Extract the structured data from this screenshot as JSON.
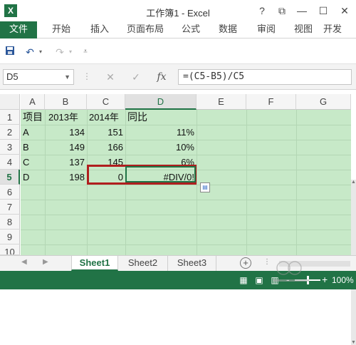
{
  "window": {
    "app_icon": "X",
    "title": "工作簿1 - Excel",
    "help": "?",
    "ribbon_display": "⧉",
    "minimize": "—",
    "maximize": "☐",
    "close": "✕"
  },
  "ribbon": {
    "tabs": [
      "文件",
      "开始",
      "插入",
      "页面布局",
      "公式",
      "数据",
      "审阅",
      "视图",
      "开发"
    ]
  },
  "qat": {
    "save_icon": "save-icon",
    "undo_icon": "undo-icon",
    "redo_icon": "redo-icon"
  },
  "formula_bar": {
    "name_box": "D5",
    "cancel": "✕",
    "enter": "✓",
    "fx": "fx",
    "formula": "=(C5-B5)/C5"
  },
  "grid": {
    "columns": [
      "A",
      "B",
      "C",
      "D",
      "E",
      "F",
      "G"
    ],
    "selected_column": "D",
    "rows": [
      "1",
      "2",
      "3",
      "4",
      "5",
      "6",
      "7",
      "8",
      "9",
      "10"
    ],
    "selected_row": "5",
    "header": [
      "项目",
      "2013年",
      "2014年",
      "同比"
    ],
    "data": [
      [
        "A",
        "134",
        "151",
        "11%"
      ],
      [
        "B",
        "149",
        "166",
        "10%"
      ],
      [
        "C",
        "137",
        "145",
        "6%"
      ],
      [
        "D",
        "198",
        "0",
        "#DIV/0!"
      ]
    ]
  },
  "sheets": {
    "tabs": [
      "Sheet1",
      "Sheet2",
      "Sheet3"
    ],
    "active": "Sheet1",
    "add": "+"
  },
  "status": {
    "zoom_minus": "-",
    "zoom_plus": "+",
    "zoom": "100%"
  },
  "colors": {
    "accent": "#217346",
    "cell_fill": "#c7e9c8",
    "highlight": "#b01e1e"
  }
}
